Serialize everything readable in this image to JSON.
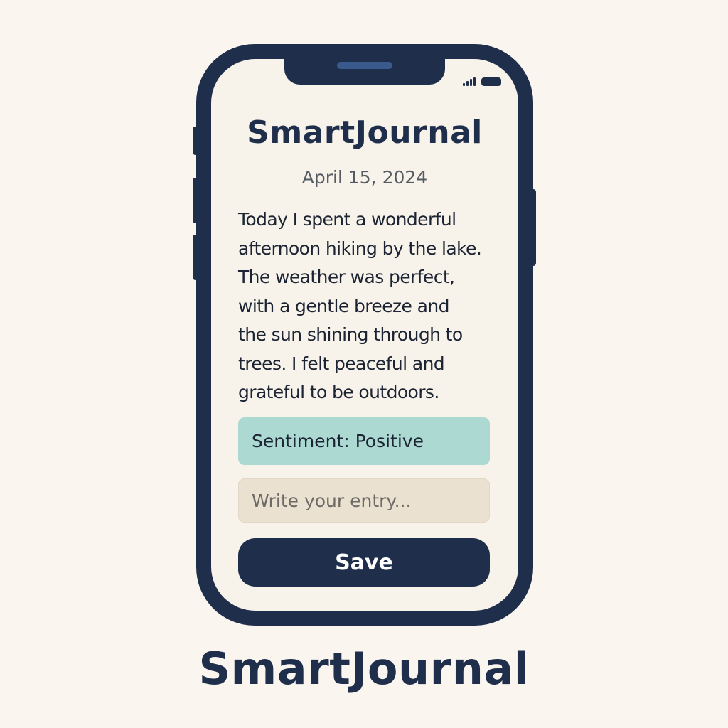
{
  "app": {
    "title": "SmartJournal"
  },
  "status_bar": {
    "icons": [
      "signal-icon",
      "battery-icon"
    ]
  },
  "entry": {
    "date": "April 15, 2024",
    "lines": [
      "Today I spent a wonderful",
      "afternoon hiking by the lake.",
      "The weather was perfect,",
      "with a gentle breeze and",
      "the sun shining through to",
      "trees. I felt peaceful and",
      "grateful to be outdoors."
    ]
  },
  "sentiment": {
    "label": "Sentiment: Positive"
  },
  "input": {
    "placeholder": "Write your entry..."
  },
  "actions": {
    "save_label": "Save"
  },
  "branding": {
    "title": "SmartJournal"
  },
  "colors": {
    "background": "#faf5ef",
    "navy": "#1f2f4b",
    "screen": "#f8f3ea",
    "sentiment_bg": "#acd9d2",
    "input_bg": "#ebe1d1"
  }
}
